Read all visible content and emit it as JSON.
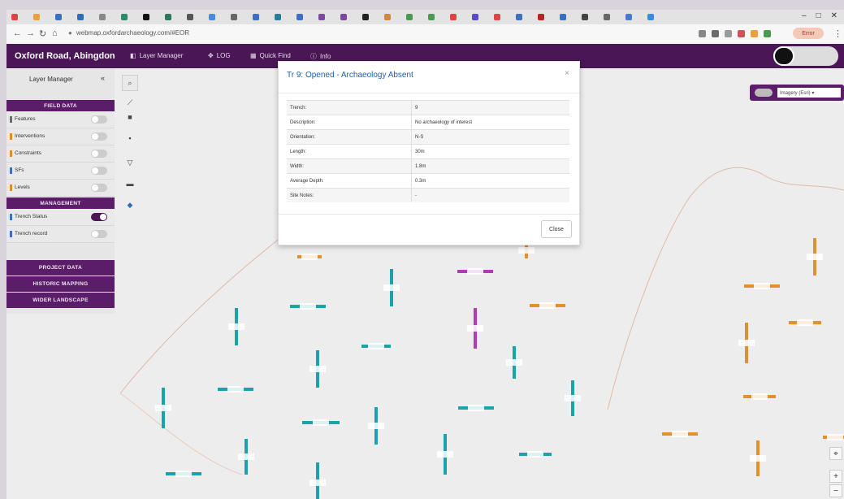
{
  "browser": {
    "url": "webmap.oxfordarchaeology.com/#EOR",
    "profile_label": "Error",
    "window_controls": [
      "–",
      "□",
      "✕"
    ]
  },
  "app": {
    "site_title": "Oxford Road, Abingdon",
    "nav": [
      {
        "label": "Layer Manager",
        "icon": "layers-icon"
      },
      {
        "label": "LOG",
        "icon": "move-icon"
      },
      {
        "label": "Quick Find",
        "icon": "grid-icon"
      },
      {
        "label": "Info",
        "icon": "info-icon"
      }
    ],
    "accent": "#4a1655"
  },
  "layer_manager": {
    "title": "Layer Manager",
    "field_data_header": "FIELD DATA",
    "field_layers": [
      {
        "label": "Features",
        "color": "#6b6b6b",
        "on": false
      },
      {
        "label": "Interventions",
        "color": "#e08a2a",
        "on": false
      },
      {
        "label": "Constraints",
        "color": "#e08a2a",
        "on": false
      },
      {
        "label": "SFs",
        "color": "#3a6fc4",
        "on": false
      },
      {
        "label": "Levels",
        "color": "#e08a2a",
        "on": false
      }
    ],
    "management_header": "MANAGEMENT",
    "management_layers": [
      {
        "label": "Trench Status",
        "color": "#3a6fc4",
        "on": true
      },
      {
        "label": "Trench record",
        "color": "#3a6fc4",
        "on": false
      }
    ],
    "other_sections": [
      "PROJECT DATA",
      "HISTORIC MAPPING",
      "WIDER LANDSCAPE"
    ]
  },
  "basemap": {
    "label": "Imagery (Esri) ▾"
  },
  "modal": {
    "title": "Tr 9: Opened - Archaeology Absent",
    "rows": [
      {
        "key": "Trench:",
        "value": "9"
      },
      {
        "key": "Description:",
        "value": "No archaeology of interest"
      },
      {
        "key": "Orientation:",
        "value": "N-S"
      },
      {
        "key": "Length:",
        "value": "30m"
      },
      {
        "key": "Width:",
        "value": "1.8m"
      },
      {
        "key": "Average Depth:",
        "value": "0.3m"
      },
      {
        "key": "Site Notes:",
        "value": "-"
      }
    ],
    "close_label": "Close"
  }
}
